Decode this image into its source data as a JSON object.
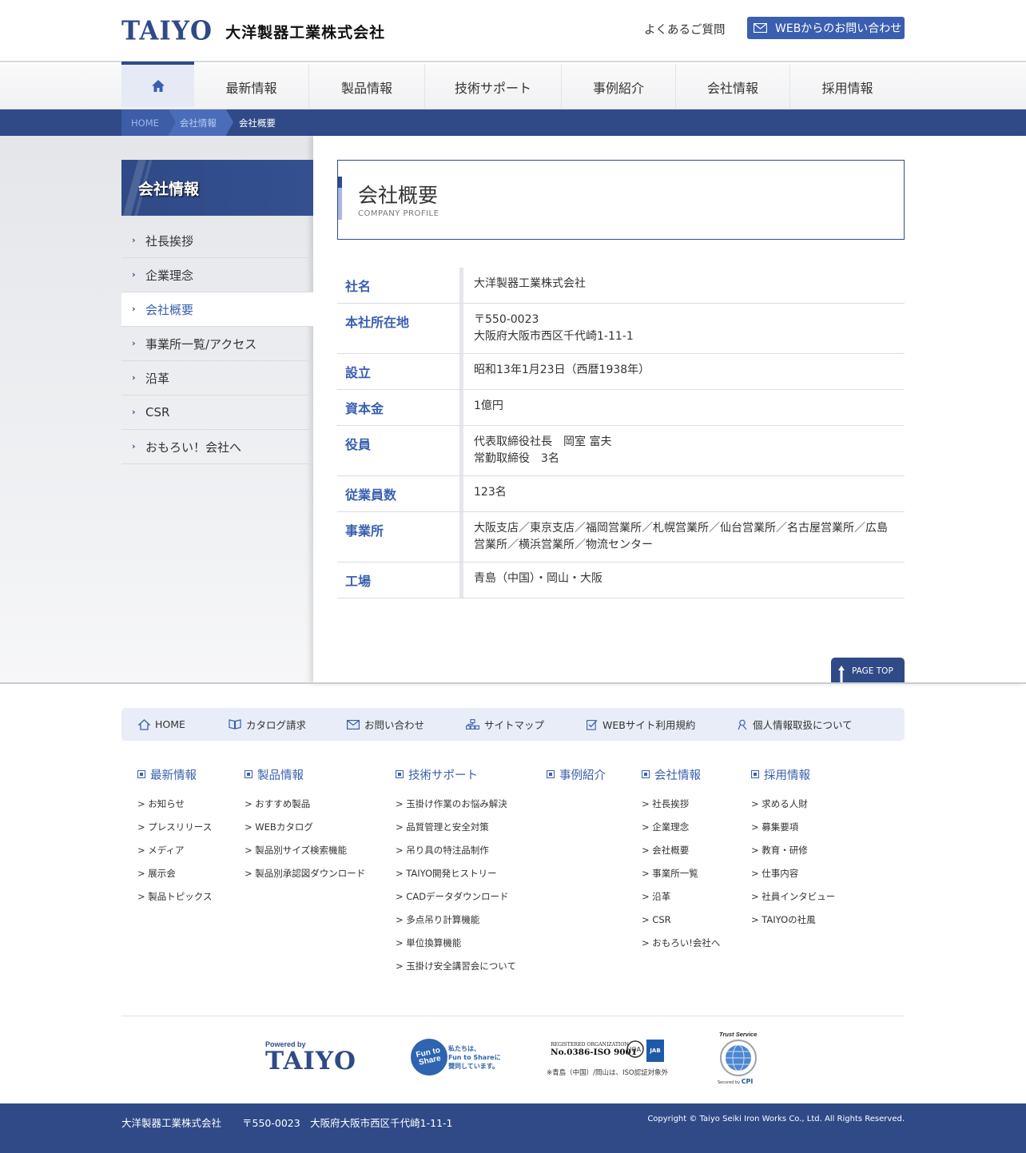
{
  "header": {
    "logo_mark": "TAIYO",
    "logo_text": "大洋製器工業株式会社",
    "faq_link": "よくあるご質問",
    "contact_button": "WEBからのお問い合わせ"
  },
  "gnav": {
    "items": [
      "最新情報",
      "製品情報",
      "技術サポート",
      "事例紹介",
      "会社情報",
      "採用情報"
    ]
  },
  "breadcrumb": {
    "home": "HOME",
    "parent": "会社情報",
    "current": "会社概要"
  },
  "sidebar": {
    "title": "会社情報",
    "items": [
      "社長挨拶",
      "企業理念",
      "会社概要",
      "事業所一覧/アクセス",
      "沿革",
      "CSR",
      "おもろい！会社へ"
    ],
    "active_index": 2
  },
  "main": {
    "title": "会社概要",
    "subtitle": "COMPANY PROFILE",
    "rows": [
      {
        "label": "社名",
        "lines": [
          "大洋製器工業株式会社"
        ]
      },
      {
        "label": "本社所在地",
        "lines": [
          "〒550-0023",
          "大阪府大阪市西区千代崎1-11-1"
        ]
      },
      {
        "label": "設立",
        "lines": [
          "昭和13年1月23日（西暦1938年）"
        ]
      },
      {
        "label": "資本金",
        "lines": [
          "1億円"
        ]
      },
      {
        "label": "役員",
        "lines": [
          "代表取締役社長　岡室 富夫",
          "常勤取締役　3名"
        ]
      },
      {
        "label": "従業員数",
        "lines": [
          "123名"
        ]
      },
      {
        "label": "事業所",
        "lines": [
          "大阪支店／東京支店／福岡営業所／札幌営業所／仙台営業所／名古屋営業所／広島",
          "営業所／横浜営業所／物流センター"
        ]
      },
      {
        "label": "工場",
        "lines": [
          "青島（中国）・岡山・大阪"
        ]
      }
    ],
    "page_top": "PAGE TOP"
  },
  "footer": {
    "util_links": [
      "HOME",
      "カタログ請求",
      "お問い合わせ",
      "サイトマップ",
      "WEBサイト利用規約",
      "個人情報取扱について"
    ],
    "columns": [
      {
        "heading": "最新情報",
        "links": [
          "> お知らせ",
          "> プレスリリース",
          "> メディア",
          "> 展示会",
          "> 製品トピックス"
        ]
      },
      {
        "heading": "製品情報",
        "links": [
          "> おすすめ製品",
          "> WEBカタログ",
          "> 製品別サイズ検索機能",
          "> 製品別承認図ダウンロード"
        ]
      },
      {
        "heading": "技術サポート",
        "links": [
          "> 玉掛け作業のお悩み解決",
          "> 品質管理と安全対策",
          "> 吊り具の特注品制作",
          "> TAIYO開発ヒストリー",
          "> CADデータダウンロード",
          "> 多点吊り計算機能",
          "> 単位換算機能",
          "> 玉掛け安全講習会について"
        ]
      },
      {
        "heading": "事例紹介",
        "links": []
      },
      {
        "heading": "会社情報",
        "links": [
          "> 社長挨拶",
          "> 企業理念",
          "> 会社概要",
          "> 事業所一覧",
          "> 沿革",
          "> CSR",
          "> おもろい!会社へ"
        ]
      },
      {
        "heading": "採用情報",
        "links": [
          "> 求める人財",
          "> 募集要項",
          "> 教育・研修",
          "> 仕事内容",
          "> 社員インタビュー",
          "> TAIYOの社風"
        ]
      }
    ],
    "badges": {
      "powered_by": "Powered by",
      "powered_logo": "TAIYO",
      "fun_to_share_logo": "Fun to Share",
      "fun_to_share_text1": "私たちは、",
      "fun_to_share_text2": "Fun to Shareに",
      "fun_to_share_text3": "賛同しています。",
      "iso_reg": "REGISTERED ORGANIZATION",
      "iso_no": "No.0386-ISO 9001",
      "iso_note": "※青島（中国）/岡山は、ISO認証対象外",
      "trust_title": "Trust Service",
      "trust_by": "Secured by",
      "trust_cpi": "CPI"
    },
    "company": "大洋製器工業株式会社",
    "address": "〒550-0023　大阪府大阪市西区千代崎1-11-1",
    "copyright": "Copyright © Taiyo Seiki Iron Works Co., Ltd. All Rights Reserved."
  },
  "colors": {
    "navy": "#2f4a87",
    "accent_blue": "#3a5fb0",
    "light_bg": "#e8edf8"
  }
}
